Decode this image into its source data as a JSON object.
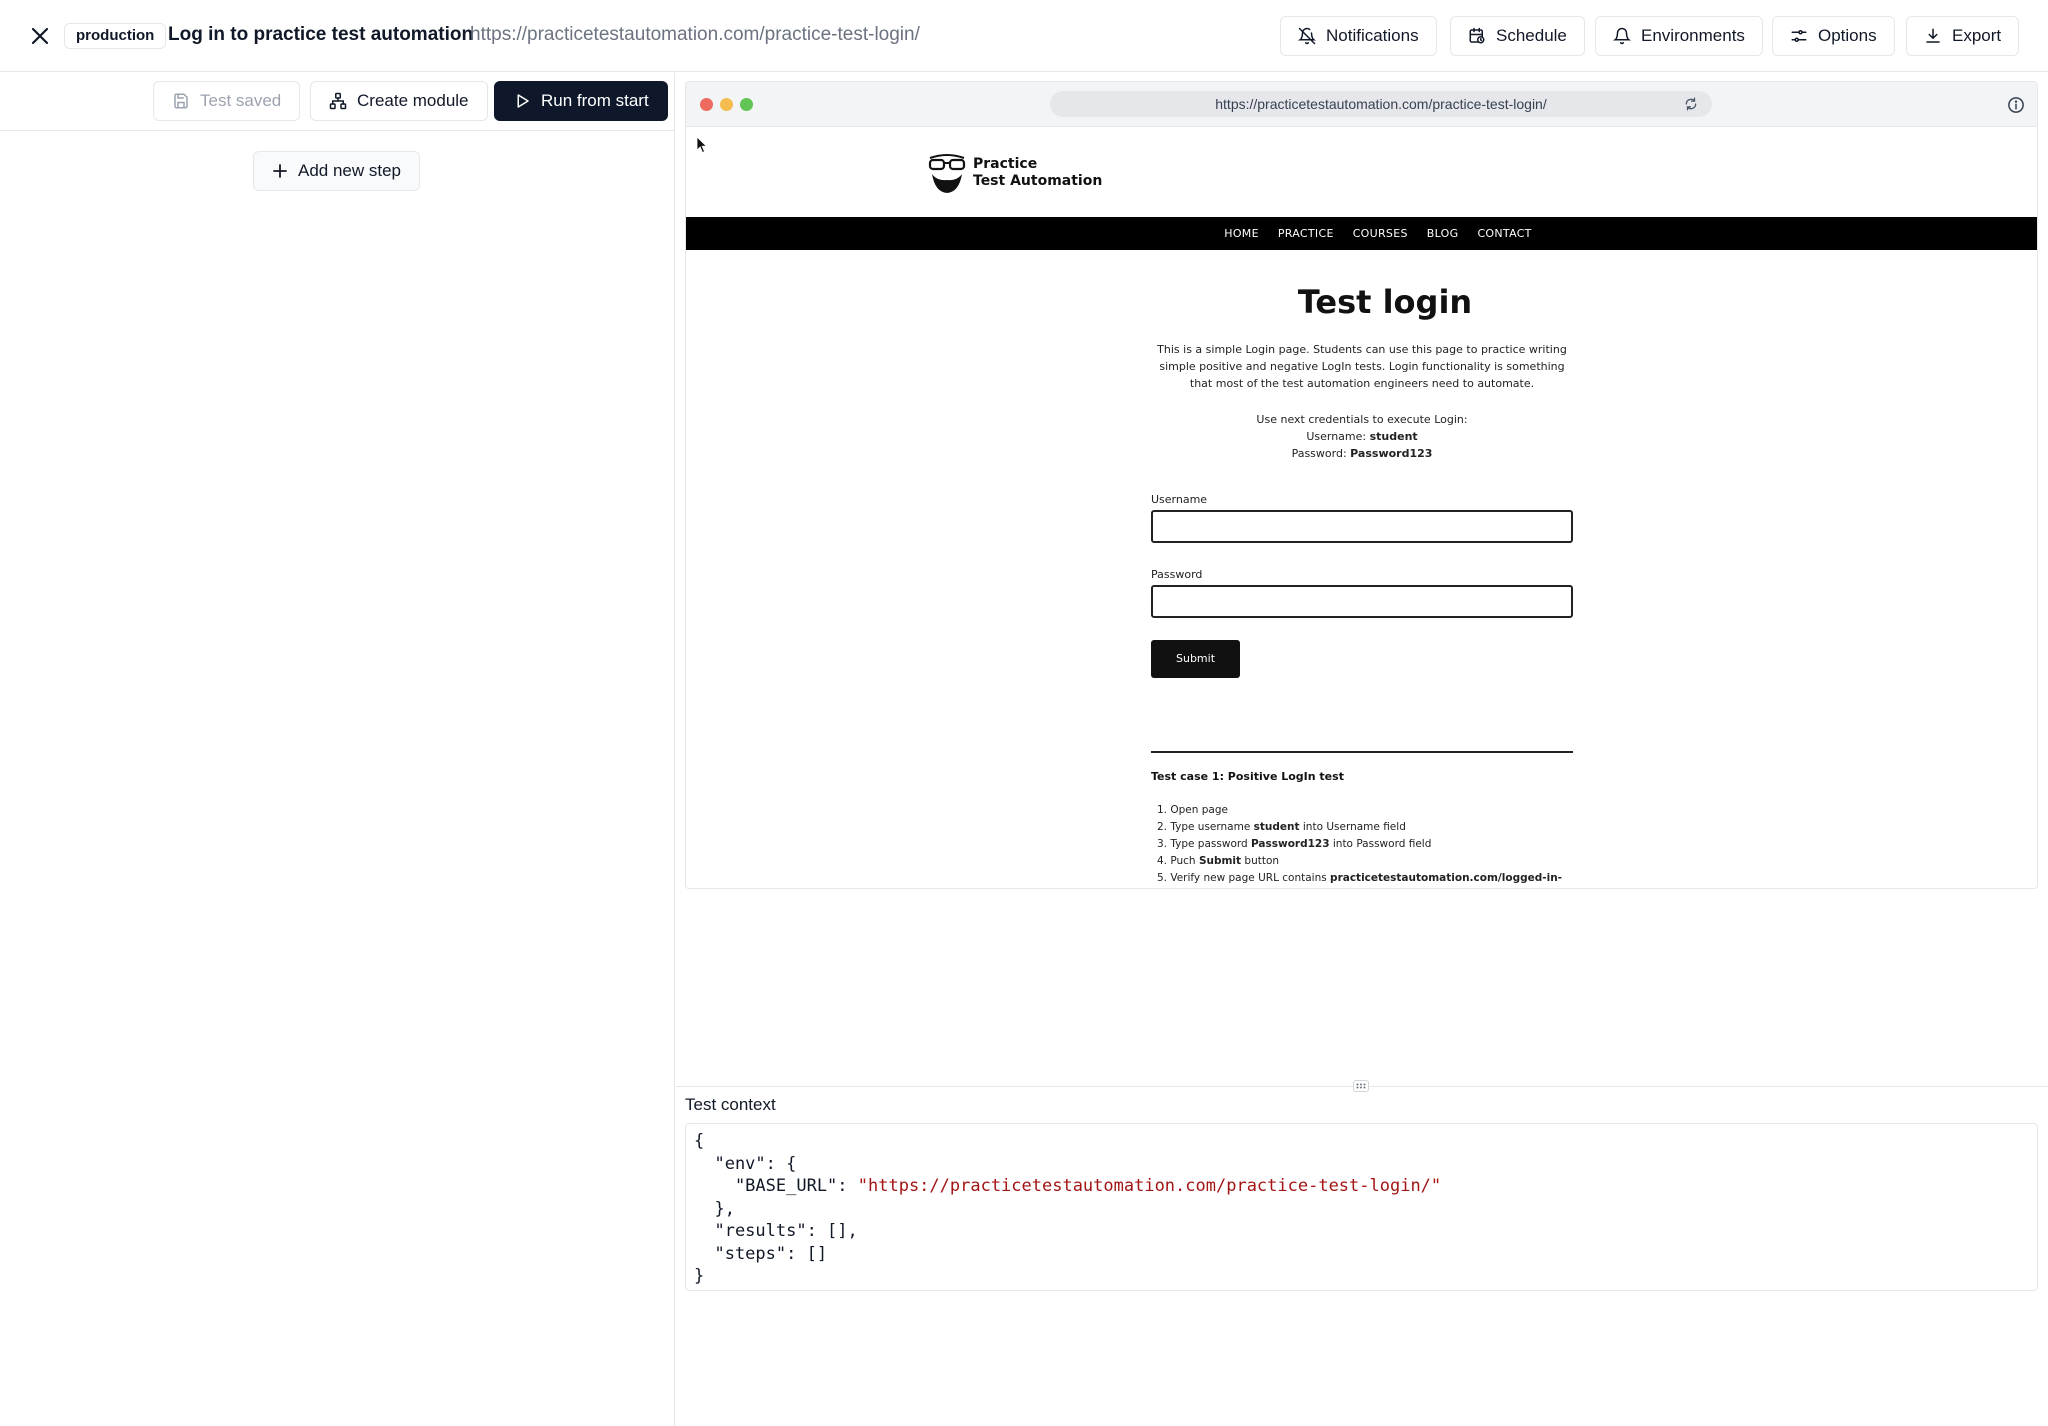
{
  "header": {
    "environment": "production",
    "title": "Log in to practice test automation",
    "url": "https://practicetestautomation.com/practice-test-login/",
    "buttons": {
      "notifications": "Notifications",
      "schedule": "Schedule",
      "environments": "Environments",
      "options": "Options",
      "export": "Export"
    }
  },
  "toolbar": {
    "test_saved": "Test saved",
    "create_module": "Create module",
    "run_from_start": "Run from start",
    "add_new_step": "Add new step"
  },
  "browser": {
    "address": "https://practicetestautomation.com/practice-test-login/",
    "site": {
      "logo_line1": "Practice",
      "logo_line2": "Test Automation",
      "nav": [
        "HOME",
        "PRACTICE",
        "COURSES",
        "BLOG",
        "CONTACT"
      ],
      "heading": "Test login",
      "intro": "This is a simple Login page. Students can use this page to practice writing simple positive and negative LogIn tests. Login functionality is something that most of the test automation engineers need to automate.",
      "creds_intro": "Use next credentials to execute Login:",
      "username_label": "Username:",
      "username_value": "student",
      "password_label": "Password:",
      "password_value": "Password123",
      "field_username": "Username",
      "field_password": "Password",
      "submit": "Submit",
      "test_case_title": "Test case 1: Positive LogIn test",
      "steps": [
        {
          "pre": "1. Open page",
          "bold": "",
          "post": ""
        },
        {
          "pre": "2. Type username ",
          "bold": "student",
          "post": " into Username field"
        },
        {
          "pre": "3. Type password ",
          "bold": "Password123",
          "post": " into Password field"
        },
        {
          "pre": "4. Puch ",
          "bold": "Submit",
          "post": " button"
        },
        {
          "pre": "5. Verify new page URL contains ",
          "bold": "practicetestautomation.com/logged-in-",
          "post": ""
        }
      ]
    }
  },
  "context": {
    "label": "Test context",
    "lines": {
      "l1": "{",
      "l2": "  \"env\": {",
      "l3_key": "    \"BASE_URL\": ",
      "l3_value": "\"https://practicetestautomation.com/practice-test-login/\"",
      "l4": "  },",
      "l5": "  \"results\": [],",
      "l6": "  \"steps\": []",
      "l7": "}"
    }
  },
  "colors": {
    "primary_button": "#0f172a",
    "dot_red": "#ee6a5f",
    "dot_yellow": "#f5bd4f",
    "dot_green": "#61c454",
    "json_string": "#a31515"
  }
}
